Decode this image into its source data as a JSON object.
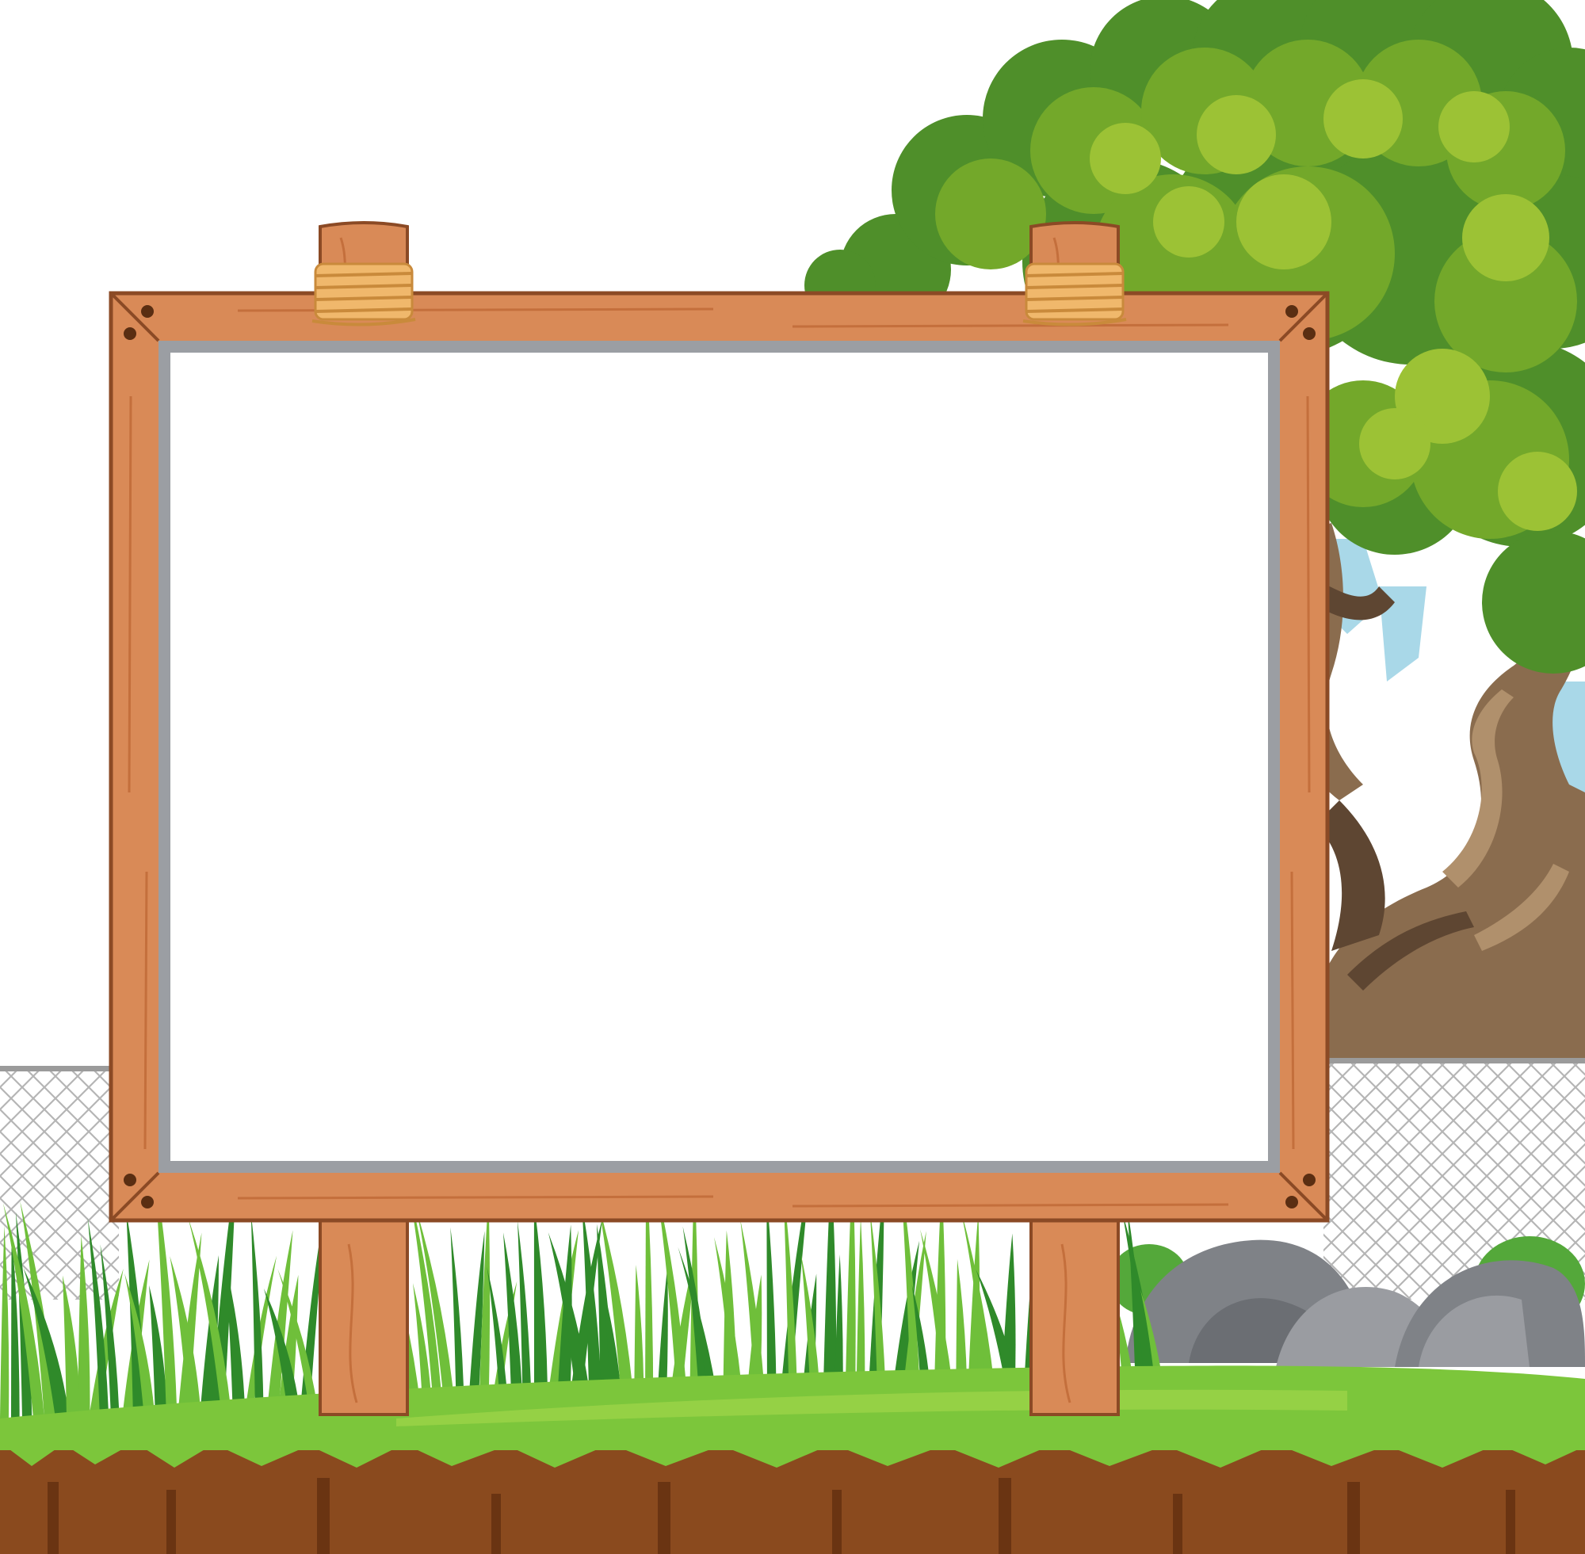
{
  "scene": {
    "description_label": "",
    "colors": {
      "background": "#ffffff",
      "sky": "#a9d8e8",
      "board_face": "#ffffff",
      "board_inner_border": "#9b9ea3",
      "wood_light": "#d98a57",
      "wood_mid": "#c46f3c",
      "wood_dark": "#8b4a25",
      "rope": "#f0b86c",
      "rope_dark": "#c98a3b",
      "leaf_dark": "#4f8f2a",
      "leaf_mid": "#73a82a",
      "leaf_light": "#9cc235",
      "trunk": "#8a6c4e",
      "trunk_light": "#b0906c",
      "trunk_dark": "#5e4632",
      "fence_mesh": "#b5b5b5",
      "fence_rail": "#9b9b9b",
      "grass_dark": "#2f8a2a",
      "grass_light": "#6fbf3a",
      "lawn": "#7cc63b",
      "soil": "#8a4a1e",
      "soil_dark": "#6a3412",
      "rock": "#7f8287",
      "rock_light": "#9a9ca1",
      "bush": "#54a83a"
    },
    "elements": {
      "board": "blank-wooden-signboard",
      "tree": "large-tree",
      "fence": "chain-link-fence",
      "rocks": "grey-rocks",
      "grass": "tall-grass",
      "ground": "grass-ledge-with-soil"
    }
  }
}
